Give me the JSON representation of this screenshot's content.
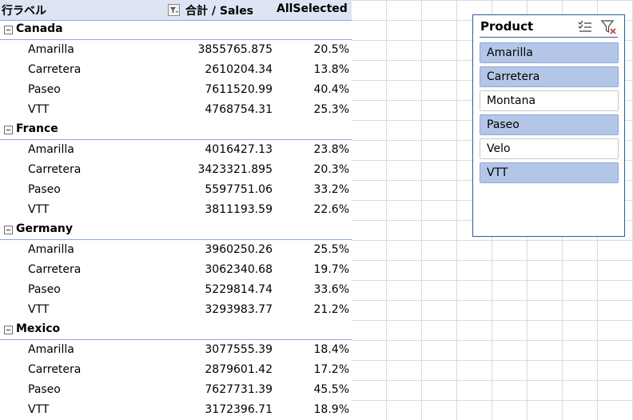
{
  "pivot": {
    "header": {
      "row_label": "行ラベル",
      "sales_label": "合計 / Sales",
      "allselected_label": "AllSelected"
    },
    "groups": [
      {
        "name": "Canada",
        "rows": [
          {
            "label": "Amarilla",
            "sales": "3855765.875",
            "pct": "20.5%"
          },
          {
            "label": "Carretera",
            "sales": "2610204.34",
            "pct": "13.8%"
          },
          {
            "label": "Paseo",
            "sales": "7611520.99",
            "pct": "40.4%"
          },
          {
            "label": "VTT",
            "sales": "4768754.31",
            "pct": "25.3%"
          }
        ]
      },
      {
        "name": "France",
        "rows": [
          {
            "label": "Amarilla",
            "sales": "4016427.13",
            "pct": "23.8%"
          },
          {
            "label": "Carretera",
            "sales": "3423321.895",
            "pct": "20.3%"
          },
          {
            "label": "Paseo",
            "sales": "5597751.06",
            "pct": "33.2%"
          },
          {
            "label": "VTT",
            "sales": "3811193.59",
            "pct": "22.6%"
          }
        ]
      },
      {
        "name": "Germany",
        "rows": [
          {
            "label": "Amarilla",
            "sales": "3960250.26",
            "pct": "25.5%"
          },
          {
            "label": "Carretera",
            "sales": "3062340.68",
            "pct": "19.7%"
          },
          {
            "label": "Paseo",
            "sales": "5229814.74",
            "pct": "33.6%"
          },
          {
            "label": "VTT",
            "sales": "3293983.77",
            "pct": "21.2%"
          }
        ]
      },
      {
        "name": "Mexico",
        "rows": [
          {
            "label": "Amarilla",
            "sales": "3077555.39",
            "pct": "18.4%"
          },
          {
            "label": "Carretera",
            "sales": "2879601.42",
            "pct": "17.2%"
          },
          {
            "label": "Paseo",
            "sales": "7627731.39",
            "pct": "45.5%"
          },
          {
            "label": "VTT",
            "sales": "3172396.71",
            "pct": "18.9%"
          }
        ]
      }
    ]
  },
  "slicer": {
    "title": "Product",
    "icons": [
      "multi-select-icon",
      "clear-filter-icon"
    ],
    "items": [
      {
        "label": "Amarilla",
        "selected": true
      },
      {
        "label": "Carretera",
        "selected": true
      },
      {
        "label": "Montana",
        "selected": false
      },
      {
        "label": "Paseo",
        "selected": true
      },
      {
        "label": "Velo",
        "selected": false
      },
      {
        "label": "VTT",
        "selected": true
      }
    ]
  },
  "colors": {
    "accent": "#2e5aa8",
    "header_bg": "#dde5f4",
    "selected_item": "#b4c6e7",
    "border_blue": "#8ea9db"
  }
}
